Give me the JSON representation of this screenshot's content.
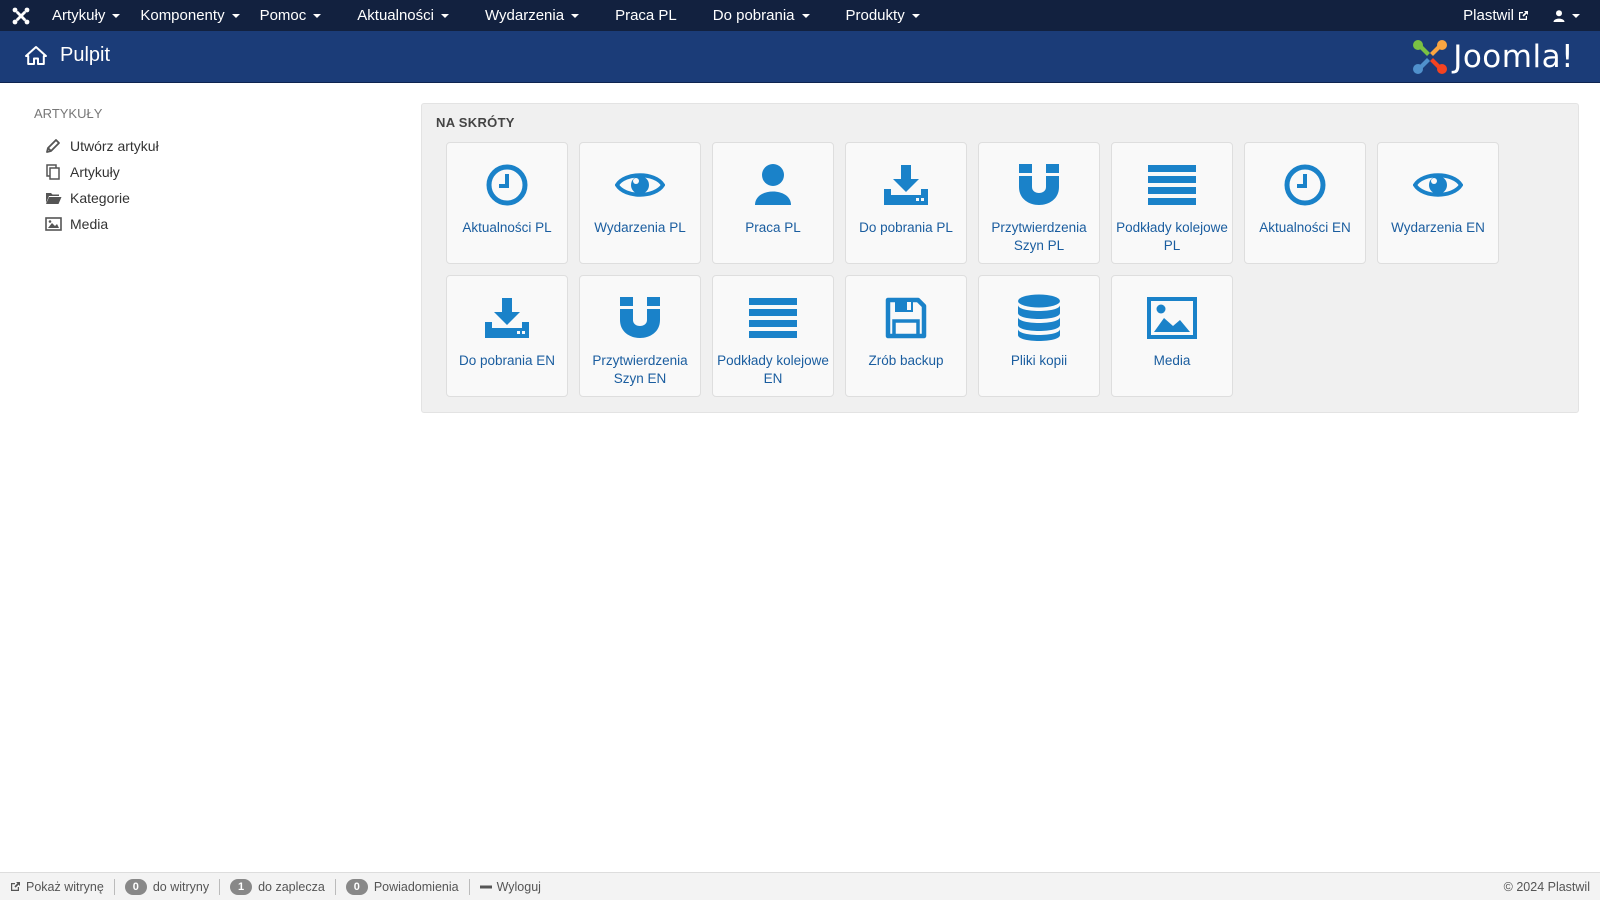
{
  "topnav": {
    "menu": [
      {
        "label": "Artykuły",
        "dropdown": true
      },
      {
        "label": "Komponenty",
        "dropdown": true
      },
      {
        "label": "Pomoc",
        "dropdown": true
      },
      {
        "label": "Aktualności",
        "dropdown": true
      },
      {
        "label": "Wydarzenia",
        "dropdown": true
      },
      {
        "label": "Praca PL",
        "dropdown": false
      },
      {
        "label": "Do pobrania",
        "dropdown": true
      },
      {
        "label": "Produkty",
        "dropdown": true
      }
    ],
    "site_link": "Plastwil"
  },
  "subheader": {
    "title": "Pulpit",
    "brand": "Joomla!"
  },
  "sidebar": {
    "heading": "ARTYKUŁY",
    "items": [
      {
        "label": "Utwórz artykuł",
        "icon": "pencil-icon"
      },
      {
        "label": "Artykuły",
        "icon": "copy-icon"
      },
      {
        "label": "Kategorie",
        "icon": "folder-icon"
      },
      {
        "label": "Media",
        "icon": "image-icon"
      }
    ]
  },
  "shortcuts": {
    "title": "NA SKRÓTY",
    "tiles": [
      {
        "label": "Aktualności PL",
        "icon": "clock-icon"
      },
      {
        "label": "Wydarzenia PL",
        "icon": "eye-icon"
      },
      {
        "label": "Praca PL",
        "icon": "user-icon"
      },
      {
        "label": "Do pobrania PL",
        "icon": "download-icon"
      },
      {
        "label": "Przytwierdzenia Szyn PL",
        "icon": "magnet-icon"
      },
      {
        "label": "Podkłady kolejowe PL",
        "icon": "list-icon"
      },
      {
        "label": "Aktualności EN",
        "icon": "clock-icon"
      },
      {
        "label": "Wydarzenia EN",
        "icon": "eye-icon"
      },
      {
        "label": "Do pobrania EN",
        "icon": "download-icon"
      },
      {
        "label": "Przytwierdzenia Szyn EN",
        "icon": "magnet-icon"
      },
      {
        "label": "Podkłady kolejowe EN",
        "icon": "list-icon"
      },
      {
        "label": "Zrób backup",
        "icon": "floppy-icon"
      },
      {
        "label": "Pliki kopii",
        "icon": "database-icon"
      },
      {
        "label": "Media",
        "icon": "image-icon"
      }
    ]
  },
  "statusbar": {
    "view_site": "Pokaż witrynę",
    "site_visitors_count": "0",
    "site_visitors_label": "do witryny",
    "admin_users_count": "1",
    "admin_users_label": "do zaplecza",
    "messages_count": "0",
    "messages_label": "Powiadomienia",
    "logout": "Wyloguj",
    "copyright": "© 2024 Plastwil"
  },
  "colors": {
    "topnav_bg": "#12213f",
    "subheader_bg": "#1b3c78",
    "accent_blue": "#1a82c9",
    "link_blue": "#1a5d9f"
  }
}
